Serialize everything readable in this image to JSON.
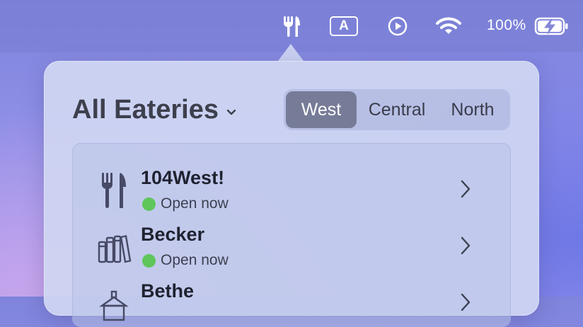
{
  "menubar": {
    "keyboard_input_letter": "A",
    "battery_percent": "100%",
    "icons": [
      "fork-knife-icon",
      "input-source-icon",
      "play-circle-icon",
      "wifi-icon",
      "battery-charging-icon"
    ]
  },
  "popover": {
    "title": "All Eateries",
    "campus_tabs": [
      {
        "label": "West",
        "selected": true
      },
      {
        "label": "Central",
        "selected": false
      },
      {
        "label": "North",
        "selected": false
      }
    ],
    "eateries": [
      {
        "name": "104West!",
        "status": "Open now",
        "icon": "fork-knife-icon",
        "status_color": "#5ec65a"
      },
      {
        "name": "Becker",
        "status": "Open now",
        "icon": "books-icon",
        "status_color": "#5ec65a"
      },
      {
        "name": "Bethe",
        "status": "",
        "icon": "building-icon"
      }
    ]
  },
  "colors": {
    "accent_selected_tab": "#767b97",
    "open_status": "#5ec65a"
  }
}
